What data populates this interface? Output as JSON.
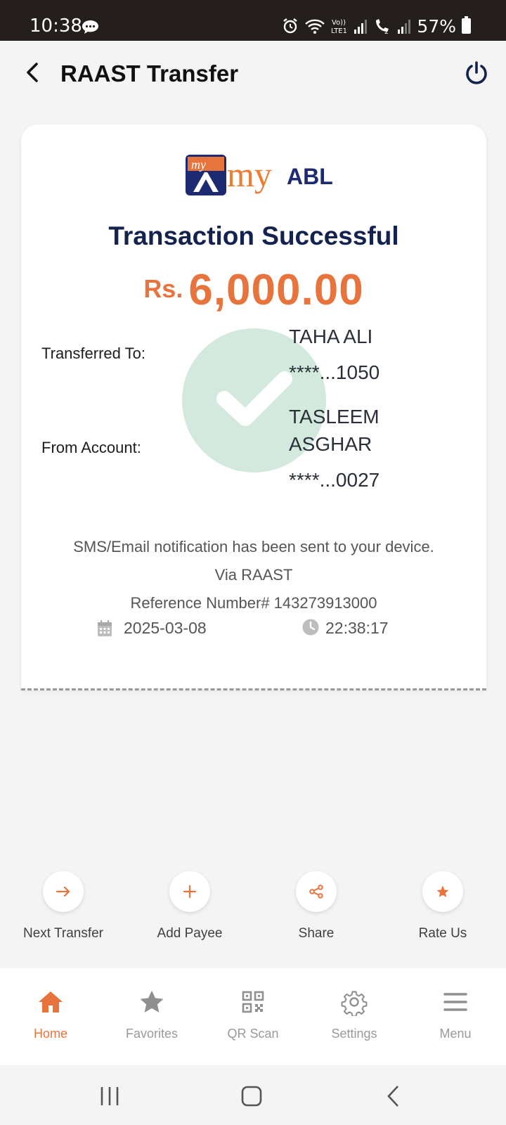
{
  "status_bar": {
    "time": "10:38",
    "battery": "57%"
  },
  "header": {
    "title": "RAAST Transfer"
  },
  "logo": {
    "word": "my",
    "brand": "ABL"
  },
  "receipt": {
    "title": "Transaction Successful",
    "currency": "Rs.",
    "amount": "6,000.00",
    "transferred_to_label": "Transferred To:",
    "to_name": "TAHA ALI",
    "to_account": "****...1050",
    "from_label": "From Account:",
    "from_name_line1": "TASLEEM",
    "from_name_line2": "ASGHAR",
    "from_account": "****...0027",
    "notification": "SMS/Email notification has been sent to your device.",
    "via": "Via RAAST",
    "reference": "Reference Number# 143273913000",
    "date": "2025-03-08",
    "time": "22:38:17"
  },
  "actions": [
    {
      "label": "Next Transfer",
      "icon": "arrow-right-icon"
    },
    {
      "label": "Add Payee",
      "icon": "plus-icon"
    },
    {
      "label": "Share",
      "icon": "share-icon"
    },
    {
      "label": "Rate Us",
      "icon": "star-icon"
    }
  ],
  "bottom_nav": [
    {
      "label": "Home",
      "icon": "home-icon",
      "active": true
    },
    {
      "label": "Favorites",
      "icon": "star-icon"
    },
    {
      "label": "QR Scan",
      "icon": "qr-icon"
    },
    {
      "label": "Settings",
      "icon": "gear-icon"
    },
    {
      "label": "Menu",
      "icon": "menu-icon"
    }
  ],
  "colors": {
    "accent": "#e8743d",
    "navy": "#13224f",
    "success_circle": "#d3e9dd"
  }
}
